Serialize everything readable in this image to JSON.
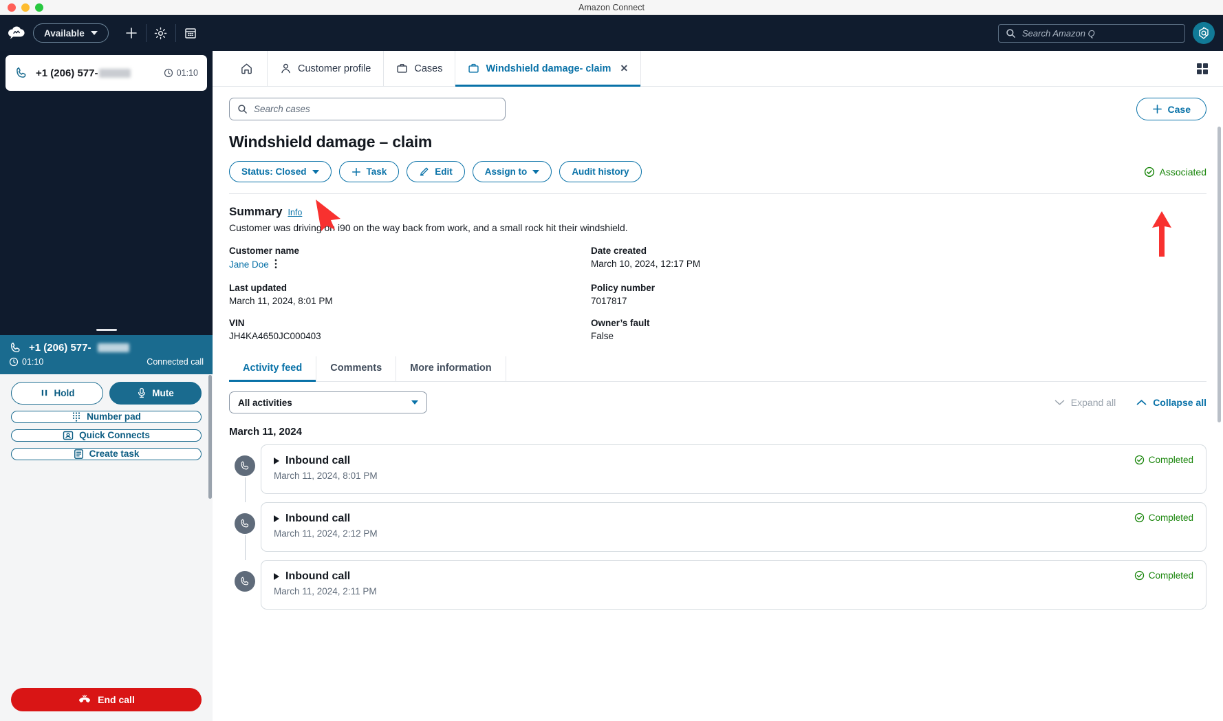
{
  "window": {
    "title": "Amazon Connect"
  },
  "ccp": {
    "logo_icon": "amazon-connect-cloud-logo",
    "status": {
      "label": "Available",
      "icon": "chevron-down-icon"
    },
    "add_icon": "plus-icon",
    "settings_icon": "gear-icon",
    "calendar_icon": "calendar-icon",
    "contact_card": {
      "phone": "+1 (206) 577-",
      "timer": "01:10",
      "phone_icon": "phone-icon",
      "clock_icon": "clock-icon"
    },
    "call_banner": {
      "phone": "+1 (206) 577-",
      "timer": "01:10",
      "status": "Connected call"
    },
    "buttons": [
      {
        "label": "Hold",
        "icon": "pause-icon",
        "style": "outline"
      },
      {
        "label": "Mute",
        "icon": "microphone-icon",
        "style": "filled"
      },
      {
        "label": "Number pad",
        "icon": "dialpad-icon",
        "style": "outline"
      },
      {
        "label": "Quick Connects",
        "icon": "contact-card-icon",
        "style": "outline"
      },
      {
        "label": "Create task",
        "icon": "task-icon",
        "style": "outline"
      }
    ],
    "end_call": {
      "label": "End call",
      "icon": "end-call-icon"
    }
  },
  "topbar": {
    "search": {
      "placeholder": "Search Amazon Q",
      "icon": "search-icon"
    },
    "avatar_icon": "amazon-q-avatar-icon"
  },
  "tabs": {
    "home_icon": "home-icon",
    "items": [
      {
        "label": "Customer profile",
        "icon": "user-icon",
        "active": false
      },
      {
        "label": "Cases",
        "icon": "briefcase-icon",
        "active": false
      },
      {
        "label": "Windshield damage- claim",
        "icon": "briefcase-icon",
        "active": true,
        "closable": true
      }
    ],
    "grid_icon": "app-grid-icon"
  },
  "subbar": {
    "search_placeholder": "Search cases",
    "search_icon": "search-icon",
    "case_button": {
      "label": "Case",
      "icon": "plus-icon"
    }
  },
  "case": {
    "title": "Windshield damage – claim",
    "actions": [
      {
        "label": "Status: Closed",
        "icon": "chevron-down-icon",
        "kind": "dropdown"
      },
      {
        "label": "Task",
        "icon": "plus-icon",
        "kind": "button"
      },
      {
        "label": "Edit",
        "icon": "pencil-icon",
        "kind": "button"
      },
      {
        "label": "Assign to",
        "icon": "chevron-down-icon",
        "kind": "dropdown"
      },
      {
        "label": "Audit history",
        "icon": "",
        "kind": "button"
      }
    ],
    "association": {
      "label": "Associated",
      "icon": "check-circle-icon",
      "color": "#18850a"
    },
    "summary": {
      "heading": "Summary",
      "info_link": "Info",
      "text": "Customer was driving on i90 on the way back from work, and a small rock hit their windshield."
    },
    "fields": [
      {
        "label": "Customer name",
        "value": "Jane Doe",
        "is_link": true,
        "has_menu": true,
        "menu_icon": "kebab-menu-icon"
      },
      {
        "label": "Date created",
        "value": "March 10, 2024, 12:17 PM",
        "is_link": false
      },
      {
        "label": "Last updated",
        "value": "March 11, 2024, 8:01 PM",
        "is_link": false
      },
      {
        "label": "Policy number",
        "value": "7017817",
        "is_link": false
      },
      {
        "label": "VIN",
        "value": "JH4KA4650JC000403",
        "is_link": false
      },
      {
        "label": "Owner’s fault",
        "value": "False",
        "is_link": false
      }
    ]
  },
  "feed_tabs": [
    {
      "label": "Activity feed",
      "active": true
    },
    {
      "label": "Comments",
      "active": false
    },
    {
      "label": "More information",
      "active": false
    }
  ],
  "feed_controls": {
    "filter_value": "All activities",
    "filter_icon": "chevron-down-icon",
    "expand_all": {
      "label": "Expand all",
      "icon": "chevron-down-icon"
    },
    "collapse_all": {
      "label": "Collapse all",
      "icon": "chevron-up-icon"
    }
  },
  "activity_feed": {
    "date_header": "March 11, 2024",
    "items": [
      {
        "title": "Inbound call",
        "timestamp": "March 11, 2024, 8:01 PM",
        "status": "Completed",
        "icon": "phone-icon",
        "status_icon": "check-circle-icon"
      },
      {
        "title": "Inbound call",
        "timestamp": "March 11, 2024, 2:12 PM",
        "status": "Completed",
        "icon": "phone-icon",
        "status_icon": "check-circle-icon"
      },
      {
        "title": "Inbound call",
        "timestamp": "March 11, 2024, 2:11 PM",
        "status": "Completed",
        "icon": "phone-icon",
        "status_icon": "check-circle-icon"
      }
    ]
  },
  "colors": {
    "accent_blue": "#0972a8",
    "ccp_teal": "#1a6b8f",
    "dark_nav": "#101c2e",
    "success_green": "#18850a",
    "danger_red": "#d91515",
    "annotation_red": "#f8312f"
  }
}
